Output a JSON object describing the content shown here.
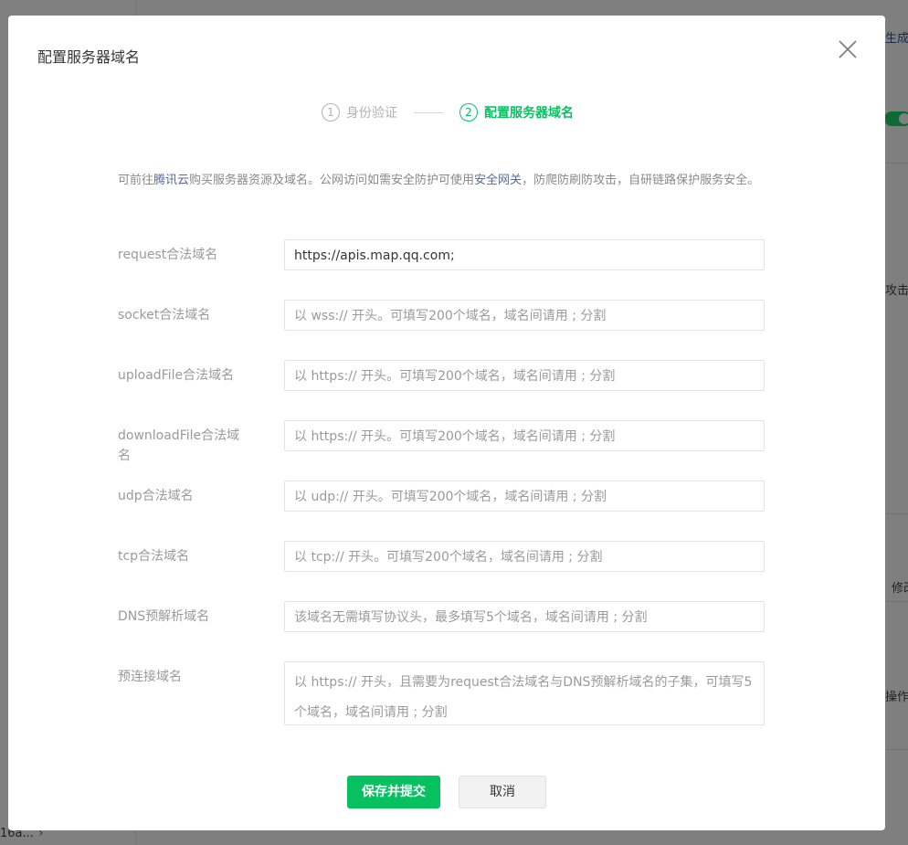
{
  "background": {
    "right_texts": [
      "生成",
      "攻击，",
      "修改",
      "操作"
    ],
    "left_bottom_text": "16a...",
    "chevron_glyph": "›"
  },
  "dialog": {
    "title": "配置服务器域名",
    "close_icon": "close-icon"
  },
  "steps": [
    {
      "number": "1",
      "label": "身份验证",
      "state": "done"
    },
    {
      "number": "2",
      "label": "配置服务器域名",
      "state": "active"
    }
  ],
  "description": {
    "part1": "可前往",
    "link1": "腾讯云",
    "part2": "购买服务器资源及域名。公网访问如需安全防护可使用",
    "link2": "安全网关",
    "part3": "，防爬防刷防攻击，自研链路保护服务安全。"
  },
  "fields": [
    {
      "label": "request合法域名",
      "value": "https://apis.map.qq.com;",
      "placeholder": ""
    },
    {
      "label": "socket合法域名",
      "value": "",
      "placeholder": "以 wss:// 开头。可填写200个域名，域名间请用 ; 分割"
    },
    {
      "label": "uploadFile合法域名",
      "value": "",
      "placeholder": "以 https:// 开头。可填写200个域名，域名间请用 ; 分割"
    },
    {
      "label": "downloadFile合法域名",
      "value": "",
      "placeholder": "以 https:// 开头。可填写200个域名，域名间请用 ; 分割"
    },
    {
      "label": "udp合法域名",
      "value": "",
      "placeholder": "以 udp:// 开头。可填写200个域名，域名间请用 ; 分割"
    },
    {
      "label": "tcp合法域名",
      "value": "",
      "placeholder": "以 tcp:// 开头。可填写200个域名，域名间请用 ; 分割"
    },
    {
      "label": "DNS预解析域名",
      "value": "",
      "placeholder": "该域名无需填写协议头，最多填写5个域名，域名间请用 ; 分割"
    },
    {
      "label": "预连接域名",
      "value": "",
      "placeholder": "以 https:// 开头，且需要为request合法域名与DNS预解析域名的子集，可填写5个域名，域名间请用 ; 分割"
    }
  ],
  "buttons": {
    "submit": "保存并提交",
    "cancel": "取消"
  },
  "colors": {
    "accent_green": "#07c160",
    "link_blue": "#576b95"
  }
}
